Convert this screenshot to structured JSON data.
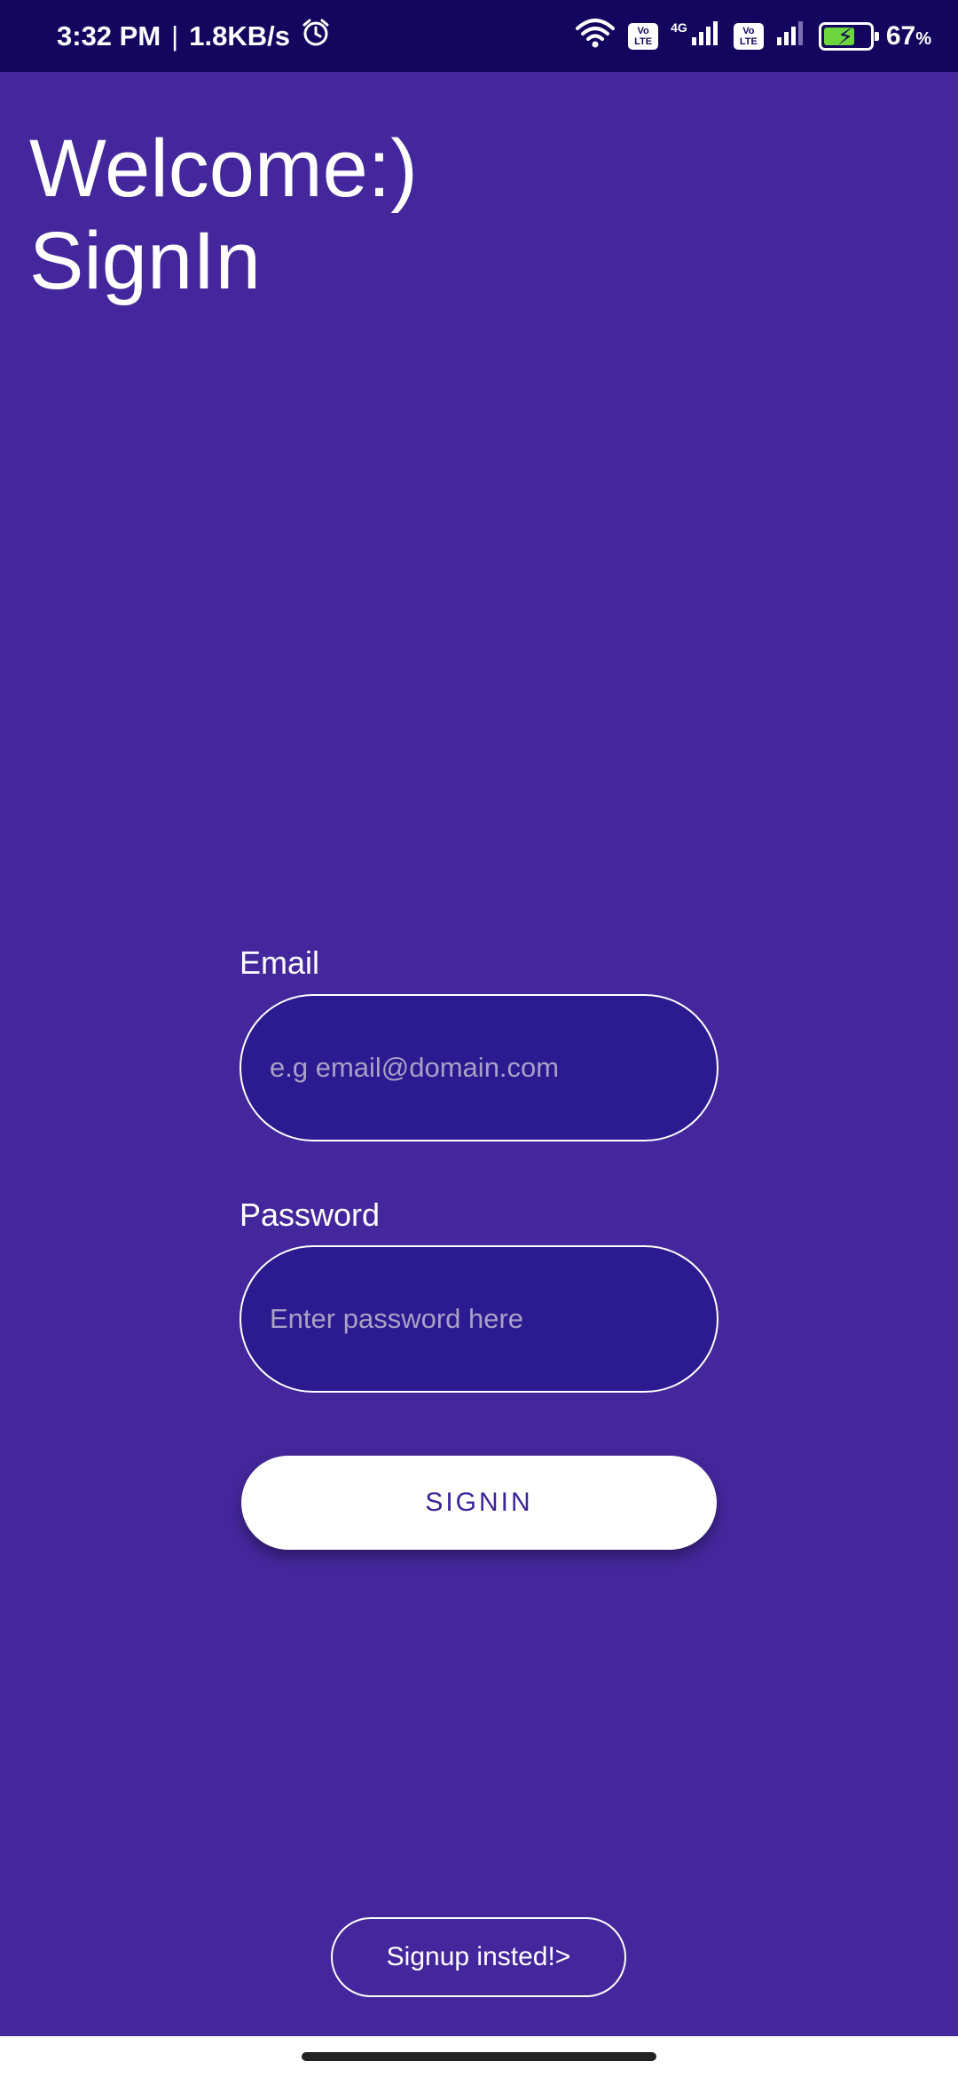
{
  "status_bar": {
    "time": "3:32 PM",
    "separator": "|",
    "net_speed": "1.8KB/s",
    "alarm_icon": "alarm-icon",
    "wifi_icon": "wifi-icon",
    "volte_label_top": "Vo",
    "volte_label_bottom": "LTE",
    "network_type": "4G",
    "battery_percent": "67",
    "battery_percent_sign": "%",
    "battery_level": 0.67,
    "battery_fill_color": "#6cd63c"
  },
  "header": {
    "line1": "Welcome:)",
    "line2": "SignIn"
  },
  "form": {
    "email_label": "Email",
    "email_placeholder": "e.g email@domain.com",
    "email_value": "",
    "password_label": "Password",
    "password_placeholder": "Enter password here",
    "password_value": "",
    "signin_label": "SIGNIN"
  },
  "footer": {
    "signup_label": "Signup insted!>"
  },
  "colors": {
    "background": "#44279c",
    "status_bar": "#14065e",
    "input_fill": "#2b1a90",
    "button_text": "#3b2399"
  }
}
